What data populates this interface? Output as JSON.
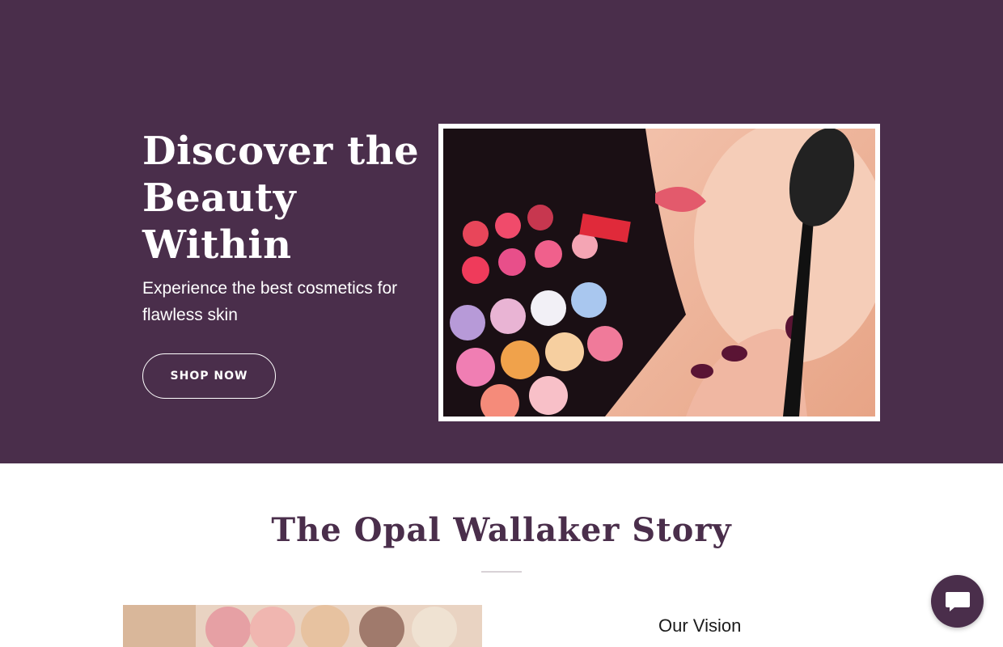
{
  "hero": {
    "title": "Discover the Beauty Within",
    "subtitle": "Experience the best cosmetics for flawless skin",
    "cta_label": "SHOP NOW",
    "background_color": "#4a2e4b"
  },
  "story": {
    "title": "The Opal Wallaker Story",
    "vision_heading": "Our Vision"
  },
  "chat": {
    "icon": "chat-bubble-icon",
    "color": "#4a2e4b"
  },
  "images": {
    "hero": "makeup-brush-on-cheek-photo",
    "story": "eyeshadow-palette-photo"
  }
}
